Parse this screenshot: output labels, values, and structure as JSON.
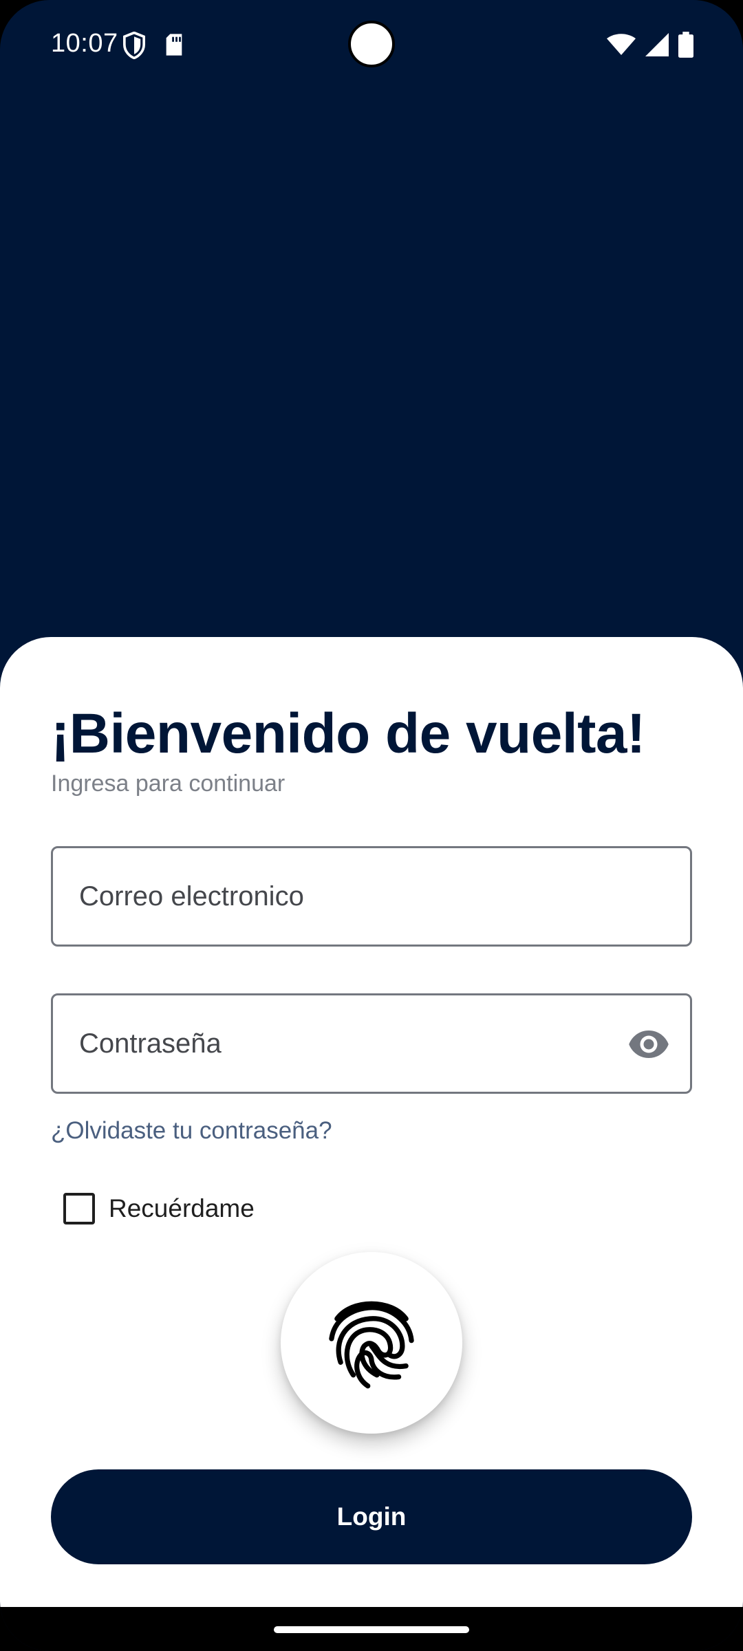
{
  "status_bar": {
    "time": "10:07",
    "icons": [
      "shield-icon",
      "sd-card-icon",
      "wifi-icon",
      "signal-icon",
      "battery-icon"
    ]
  },
  "login": {
    "title": "¡Bienvenido de vuelta!",
    "subtitle": "Ingresa para continuar",
    "email_placeholder": "Correo electronico",
    "email_value": "",
    "password_placeholder": "Contraseña",
    "password_value": "",
    "forgot_password": "¿Olvidaste tu contraseña?",
    "remember_label": "Recuérdame",
    "remember_checked": false,
    "login_label": "Login",
    "fingerprint_icon": "fingerprint-icon",
    "eye_icon": "visibility-icon"
  },
  "colors": {
    "primary": "#001637",
    "link": "#4a5f7f",
    "subtitle": "#7c8088",
    "background": "#ffffff"
  }
}
